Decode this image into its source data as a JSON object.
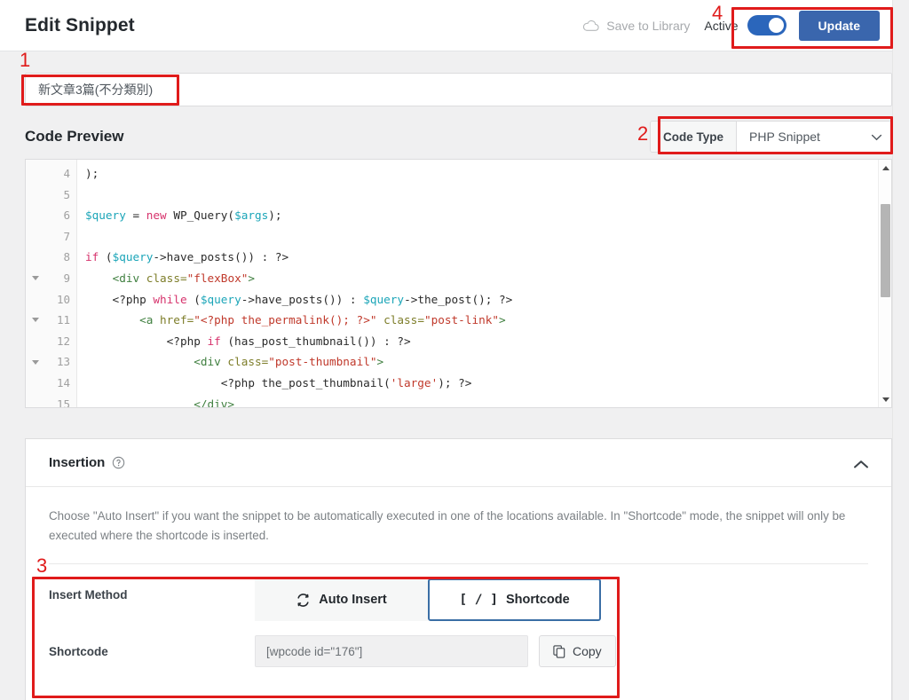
{
  "header": {
    "title": "Edit Snippet",
    "save_to_library": "Save to Library",
    "save_icon": "cloud-icon",
    "active_label": "Active",
    "active_on": true,
    "update_label": "Update"
  },
  "snippet": {
    "title_value": "新文章3篇(不分類別)"
  },
  "code_preview": {
    "label": "Code Preview",
    "code_type_label": "Code Type",
    "code_type_value": "PHP Snippet",
    "chevron_icon": "chevron-down-icon",
    "lines": [
      {
        "number": "4",
        "fold": false,
        "tokens": [
          {
            "t": "plain",
            "s": ");"
          }
        ]
      },
      {
        "number": "5",
        "fold": false,
        "tokens": [
          {
            "t": "plain",
            "s": ""
          }
        ]
      },
      {
        "number": "6",
        "fold": false,
        "tokens": [
          {
            "t": "var",
            "s": "$query"
          },
          {
            "t": "plain",
            "s": " = "
          },
          {
            "t": "kw",
            "s": "new"
          },
          {
            "t": "plain",
            "s": " WP_Query("
          },
          {
            "t": "var",
            "s": "$args"
          },
          {
            "t": "plain",
            "s": ");"
          }
        ]
      },
      {
        "number": "7",
        "fold": false,
        "tokens": [
          {
            "t": "plain",
            "s": ""
          }
        ]
      },
      {
        "number": "8",
        "fold": false,
        "tokens": [
          {
            "t": "kw",
            "s": "if"
          },
          {
            "t": "plain",
            "s": " ("
          },
          {
            "t": "var",
            "s": "$query"
          },
          {
            "t": "plain",
            "s": "->have_posts()) : ?>"
          }
        ]
      },
      {
        "number": "9",
        "fold": true,
        "tokens": [
          {
            "t": "plain",
            "s": "    "
          },
          {
            "t": "tag",
            "s": "<div "
          },
          {
            "t": "attr",
            "s": "class="
          },
          {
            "t": "str",
            "s": "\"flexBox\""
          },
          {
            "t": "tag",
            "s": ">"
          }
        ]
      },
      {
        "number": "10",
        "fold": false,
        "tokens": [
          {
            "t": "plain",
            "s": "    <?php "
          },
          {
            "t": "kw",
            "s": "while"
          },
          {
            "t": "plain",
            "s": " ("
          },
          {
            "t": "var",
            "s": "$query"
          },
          {
            "t": "plain",
            "s": "->have_posts()) : "
          },
          {
            "t": "var",
            "s": "$query"
          },
          {
            "t": "plain",
            "s": "->the_post(); ?>"
          }
        ]
      },
      {
        "number": "11",
        "fold": true,
        "tokens": [
          {
            "t": "plain",
            "s": "        "
          },
          {
            "t": "tag",
            "s": "<a "
          },
          {
            "t": "attr",
            "s": "href="
          },
          {
            "t": "str",
            "s": "\"<?php the_permalink(); ?>\""
          },
          {
            "t": "plain",
            "s": " "
          },
          {
            "t": "attr",
            "s": "class="
          },
          {
            "t": "str",
            "s": "\"post-link\""
          },
          {
            "t": "tag",
            "s": ">"
          }
        ]
      },
      {
        "number": "12",
        "fold": false,
        "tokens": [
          {
            "t": "plain",
            "s": "            <?php "
          },
          {
            "t": "kw",
            "s": "if"
          },
          {
            "t": "plain",
            "s": " (has_post_thumbnail()) : ?>"
          }
        ]
      },
      {
        "number": "13",
        "fold": true,
        "tokens": [
          {
            "t": "plain",
            "s": "                "
          },
          {
            "t": "tag",
            "s": "<div "
          },
          {
            "t": "attr",
            "s": "class="
          },
          {
            "t": "str",
            "s": "\"post-thumbnail\""
          },
          {
            "t": "tag",
            "s": ">"
          }
        ]
      },
      {
        "number": "14",
        "fold": false,
        "tokens": [
          {
            "t": "plain",
            "s": "                    <?php the_post_thumbnail("
          },
          {
            "t": "str",
            "s": "'large'"
          },
          {
            "t": "plain",
            "s": "); ?>"
          }
        ]
      },
      {
        "number": "15",
        "fold": false,
        "tokens": [
          {
            "t": "plain",
            "s": "                "
          },
          {
            "t": "tag",
            "s": "</div>"
          }
        ]
      }
    ]
  },
  "insertion": {
    "title": "Insertion",
    "help_icon": "question-circle-icon",
    "collapse_icon": "chevron-up-icon",
    "description": "Choose \"Auto Insert\" if you want the snippet to be automatically executed in one of the locations available. In \"Shortcode\" mode, the snippet will only be executed where the shortcode is inserted.",
    "insert_method_label": "Insert Method",
    "auto_insert_label": "Auto Insert",
    "auto_insert_icon": "sync-icon",
    "shortcode_button_label": "Shortcode",
    "shortcode_button_bracket": "[ / ]",
    "selected_method": "Shortcode",
    "shortcode_label": "Shortcode",
    "shortcode_value": "[wpcode id=\"176\"]",
    "copy_label": "Copy",
    "copy_icon": "copy-icon"
  },
  "annotations": [
    {
      "id": "1",
      "label": "1",
      "target": "snippet-title-input"
    },
    {
      "id": "2",
      "label": "2",
      "target": "code-type-selector"
    },
    {
      "id": "3",
      "label": "3",
      "target": "insert-method-section"
    },
    {
      "id": "4",
      "label": "4",
      "target": "active-toggle-and-update"
    }
  ],
  "colors": {
    "accent": "#3a66ad",
    "toggle_on": "#2b66bb",
    "annotation": "#e01b1b",
    "page_bg": "#f0f0f1"
  }
}
